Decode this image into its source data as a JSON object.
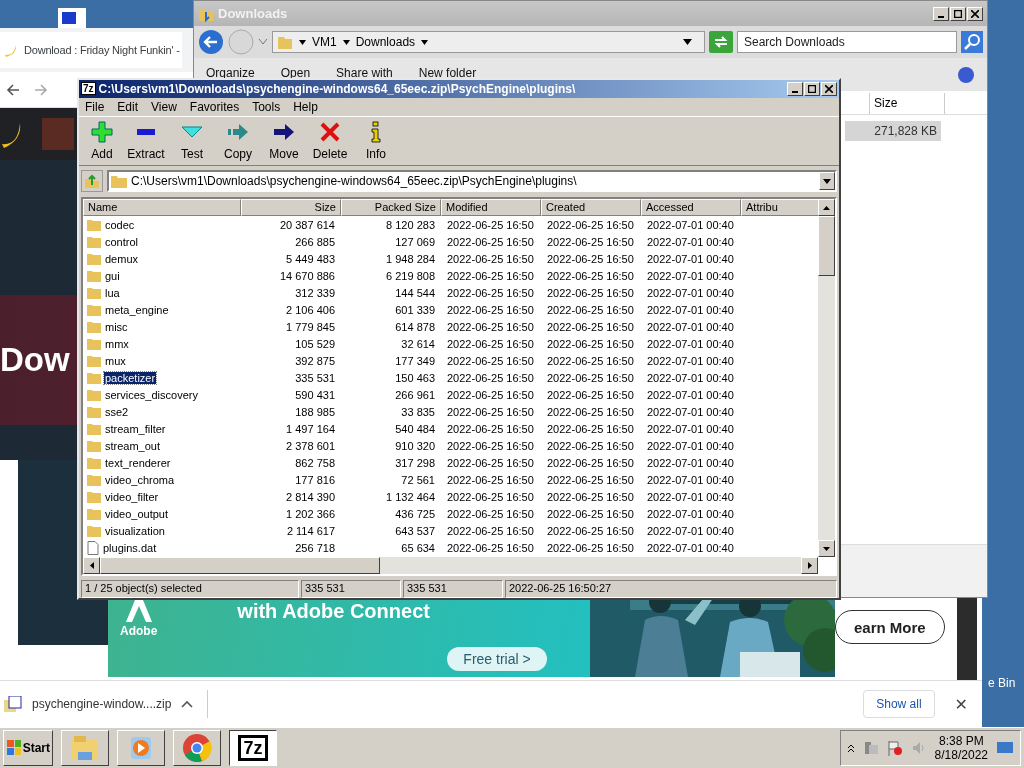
{
  "desktop": {
    "recycle_bin_label": "e Bin"
  },
  "browser": {
    "tab_title": "Download : Friday Night Funkin' -",
    "hero_text": "Dow",
    "ad": {
      "headline": "with Adobe Connect",
      "brand": "Adobe",
      "trial_button": "Free trial >",
      "more_button": "earn More"
    },
    "download_bar": {
      "file": "psychengine-window....zip",
      "show_all": "Show all",
      "close": "✕"
    }
  },
  "explorer": {
    "title": "Downloads",
    "breadcrumb": [
      "VM1",
      "Downloads"
    ],
    "search": {
      "placeholder": "Search Downloads"
    },
    "commands": [
      "Organize",
      "Open",
      "Share with",
      "New folder"
    ],
    "column": "Size",
    "row_size": "271,828 KB"
  },
  "sevenzip": {
    "logo": "7z",
    "title": "C:\\Users\\vm1\\Downloads\\psychengine-windows64_65eec.zip\\PsychEngine\\plugins\\",
    "menu": [
      "File",
      "Edit",
      "View",
      "Favorites",
      "Tools",
      "Help"
    ],
    "toolbar": [
      {
        "label": "Add",
        "kind": "add"
      },
      {
        "label": "Extract",
        "kind": "extract"
      },
      {
        "label": "Test",
        "kind": "test"
      },
      {
        "label": "Copy",
        "kind": "copy"
      },
      {
        "label": "Move",
        "kind": "move"
      },
      {
        "label": "Delete",
        "kind": "delete"
      },
      {
        "label": "Info",
        "kind": "info"
      }
    ],
    "address": "C:\\Users\\vm1\\Downloads\\psychengine-windows64_65eec.zip\\PsychEngine\\plugins\\",
    "columns": [
      "Name",
      "Size",
      "Packed Size",
      "Modified",
      "Created",
      "Accessed",
      "Attribu"
    ],
    "rows": [
      {
        "kind": "folder",
        "name": "codec",
        "size": "20 387 614",
        "packed": "8 120 283",
        "modified": "2022-06-25 16:50",
        "created": "2022-06-25 16:50",
        "accessed": "2022-07-01 00:40",
        "selected": false
      },
      {
        "kind": "folder",
        "name": "control",
        "size": "266 885",
        "packed": "127 069",
        "modified": "2022-06-25 16:50",
        "created": "2022-06-25 16:50",
        "accessed": "2022-07-01 00:40",
        "selected": false
      },
      {
        "kind": "folder",
        "name": "demux",
        "size": "5 449 483",
        "packed": "1 948 284",
        "modified": "2022-06-25 16:50",
        "created": "2022-06-25 16:50",
        "accessed": "2022-07-01 00:40",
        "selected": false
      },
      {
        "kind": "folder",
        "name": "gui",
        "size": "14 670 886",
        "packed": "6 219 808",
        "modified": "2022-06-25 16:50",
        "created": "2022-06-25 16:50",
        "accessed": "2022-07-01 00:40",
        "selected": false
      },
      {
        "kind": "folder",
        "name": "lua",
        "size": "312 339",
        "packed": "144 544",
        "modified": "2022-06-25 16:50",
        "created": "2022-06-25 16:50",
        "accessed": "2022-07-01 00:40",
        "selected": false
      },
      {
        "kind": "folder",
        "name": "meta_engine",
        "size": "2 106 406",
        "packed": "601 339",
        "modified": "2022-06-25 16:50",
        "created": "2022-06-25 16:50",
        "accessed": "2022-07-01 00:40",
        "selected": false
      },
      {
        "kind": "folder",
        "name": "misc",
        "size": "1 779 845",
        "packed": "614 878",
        "modified": "2022-06-25 16:50",
        "created": "2022-06-25 16:50",
        "accessed": "2022-07-01 00:40",
        "selected": false
      },
      {
        "kind": "folder",
        "name": "mmx",
        "size": "105 529",
        "packed": "32 614",
        "modified": "2022-06-25 16:50",
        "created": "2022-06-25 16:50",
        "accessed": "2022-07-01 00:40",
        "selected": false
      },
      {
        "kind": "folder",
        "name": "mux",
        "size": "392 875",
        "packed": "177 349",
        "modified": "2022-06-25 16:50",
        "created": "2022-06-25 16:50",
        "accessed": "2022-07-01 00:40",
        "selected": false
      },
      {
        "kind": "folder",
        "name": "packetizer",
        "size": "335 531",
        "packed": "150 463",
        "modified": "2022-06-25 16:50",
        "created": "2022-06-25 16:50",
        "accessed": "2022-07-01 00:40",
        "selected": true
      },
      {
        "kind": "folder",
        "name": "services_discovery",
        "size": "590 431",
        "packed": "266 961",
        "modified": "2022-06-25 16:50",
        "created": "2022-06-25 16:50",
        "accessed": "2022-07-01 00:40",
        "selected": false
      },
      {
        "kind": "folder",
        "name": "sse2",
        "size": "188 985",
        "packed": "33 835",
        "modified": "2022-06-25 16:50",
        "created": "2022-06-25 16:50",
        "accessed": "2022-07-01 00:40",
        "selected": false
      },
      {
        "kind": "folder",
        "name": "stream_filter",
        "size": "1 497 164",
        "packed": "540 484",
        "modified": "2022-06-25 16:50",
        "created": "2022-06-25 16:50",
        "accessed": "2022-07-01 00:40",
        "selected": false
      },
      {
        "kind": "folder",
        "name": "stream_out",
        "size": "2 378 601",
        "packed": "910 320",
        "modified": "2022-06-25 16:50",
        "created": "2022-06-25 16:50",
        "accessed": "2022-07-01 00:40",
        "selected": false
      },
      {
        "kind": "folder",
        "name": "text_renderer",
        "size": "862 758",
        "packed": "317 298",
        "modified": "2022-06-25 16:50",
        "created": "2022-06-25 16:50",
        "accessed": "2022-07-01 00:40",
        "selected": false
      },
      {
        "kind": "folder",
        "name": "video_chroma",
        "size": "177 816",
        "packed": "72 561",
        "modified": "2022-06-25 16:50",
        "created": "2022-06-25 16:50",
        "accessed": "2022-07-01 00:40",
        "selected": false
      },
      {
        "kind": "folder",
        "name": "video_filter",
        "size": "2 814 390",
        "packed": "1 132 464",
        "modified": "2022-06-25 16:50",
        "created": "2022-06-25 16:50",
        "accessed": "2022-07-01 00:40",
        "selected": false
      },
      {
        "kind": "folder",
        "name": "video_output",
        "size": "1 202 366",
        "packed": "436 725",
        "modified": "2022-06-25 16:50",
        "created": "2022-06-25 16:50",
        "accessed": "2022-07-01 00:40",
        "selected": false
      },
      {
        "kind": "folder",
        "name": "visualization",
        "size": "2 114 617",
        "packed": "643 537",
        "modified": "2022-06-25 16:50",
        "created": "2022-06-25 16:50",
        "accessed": "2022-07-01 00:40",
        "selected": false
      },
      {
        "kind": "file",
        "name": "plugins.dat",
        "size": "256 718",
        "packed": "65 634",
        "modified": "2022-06-25 16:50",
        "created": "2022-06-25 16:50",
        "accessed": "2022-07-01 00:40",
        "selected": false
      }
    ],
    "status": [
      "1 / 25 object(s) selected",
      "335 531",
      "335 531",
      "2022-06-25 16:50:27"
    ]
  },
  "taskbar": {
    "start": "Start",
    "apps": [
      {
        "kind": "explorer",
        "selected": false
      },
      {
        "kind": "media",
        "selected": false
      },
      {
        "kind": "chrome",
        "selected": false
      },
      {
        "kind": "sevenzip",
        "selected": true,
        "logo": "7z"
      }
    ],
    "time": "8:38 PM",
    "date": "8/18/2022"
  }
}
